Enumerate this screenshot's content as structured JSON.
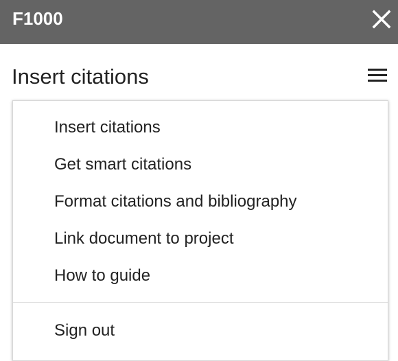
{
  "app": {
    "title": "F1000"
  },
  "header": {
    "heading": "Insert citations",
    "close_icon": "close-icon",
    "menu_icon": "hamburger-menu-icon"
  },
  "menu": {
    "items": [
      {
        "label": "Insert citations"
      },
      {
        "label": "Get smart citations"
      },
      {
        "label": "Format citations and bibliography"
      },
      {
        "label": "Link document to project"
      },
      {
        "label": "How to guide"
      }
    ],
    "sign_out": "Sign out"
  },
  "colors": {
    "titlebar_bg": "#646464",
    "title_text": "#ffffff",
    "body_text": "#222222"
  }
}
